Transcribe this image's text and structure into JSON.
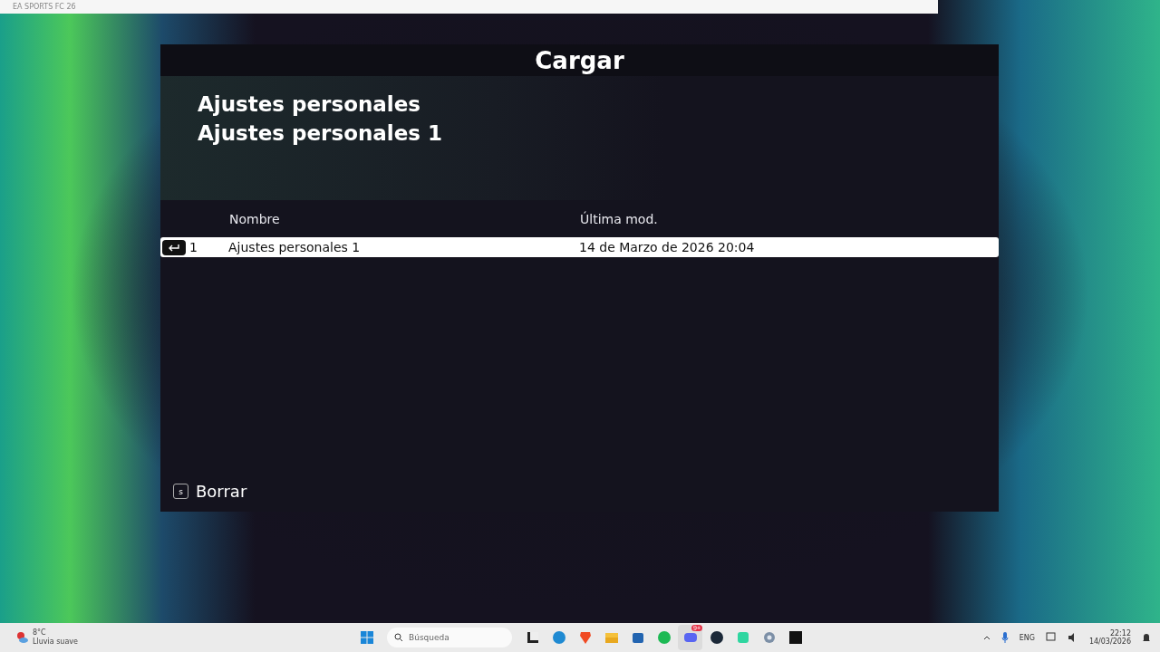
{
  "window": {
    "title": "EA SPORTS FC 26"
  },
  "dialog": {
    "title": "Cargar",
    "section": "Ajustes personales",
    "subtitle": "Ajustes personales 1",
    "columns": [
      "Nombre",
      "Última mod."
    ],
    "rows": [
      {
        "key": "1",
        "name": "Ajustes personales 1",
        "modified": "14 de Marzo de 2026 20:04",
        "selected": true
      }
    ],
    "actions": [
      {
        "key": "s",
        "label": "Borrar"
      }
    ]
  },
  "taskbar": {
    "weather": {
      "temp": "8°C",
      "condition": "Lluvia suave"
    },
    "search": {
      "placeholder": "Búsqueda"
    },
    "apps": [
      {
        "kind": "start"
      },
      {
        "kind": "terminal",
        "selected": false
      },
      {
        "kind": "edge",
        "selected": false
      },
      {
        "kind": "brave",
        "selected": false
      },
      {
        "kind": "folder",
        "selected": false
      },
      {
        "kind": "store",
        "selected": false
      },
      {
        "kind": "spotify",
        "selected": false
      },
      {
        "kind": "discord",
        "badge": "9+",
        "selected": true
      },
      {
        "kind": "steam",
        "selected": false
      },
      {
        "kind": "chat",
        "selected": false
      },
      {
        "kind": "gear",
        "selected": false
      },
      {
        "kind": "game",
        "selected": false
      }
    ],
    "language": "ENG",
    "time": "22:12",
    "date": "14/03/2026"
  }
}
